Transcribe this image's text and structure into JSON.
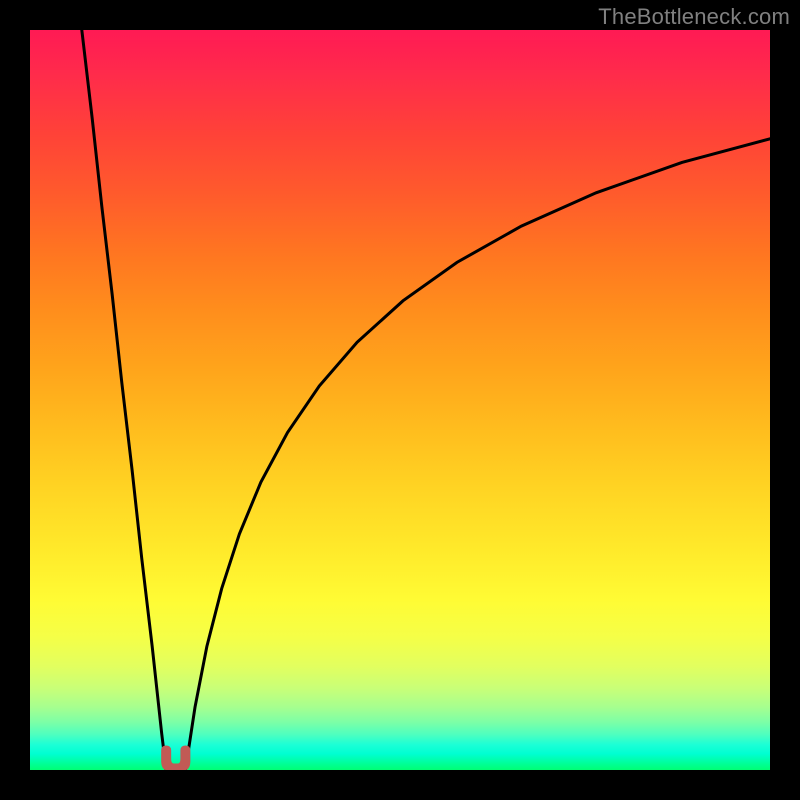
{
  "watermark": "TheBottleneck.com",
  "colors": {
    "page_bg": "#000000",
    "curve_stroke": "#000000",
    "marker_fill": "#c15a55",
    "watermark": "#808080",
    "gradient_top": "#ff1a54",
    "gradient_bottom": "#00ff74"
  },
  "chart_data": {
    "type": "line",
    "title": "",
    "xlabel": "",
    "ylabel": "",
    "xlim": [
      0,
      100
    ],
    "ylim": [
      0,
      100
    ],
    "grid": false,
    "legend": false,
    "note": "Values estimated from pixel positions; chart displays a bottleneck curve reaching 0 near x≈19.",
    "series": [
      {
        "name": "left-branch",
        "x": [
          7.0,
          8.4,
          9.7,
          11.1,
          12.4,
          13.8,
          15.1,
          16.5,
          17.8,
          18.4
        ],
        "y": [
          100.0,
          88.1,
          76.2,
          64.3,
          52.4,
          40.5,
          28.6,
          16.8,
          4.9,
          0.0
        ]
      },
      {
        "name": "right-branch",
        "x": [
          21.0,
          22.3,
          23.9,
          25.9,
          28.3,
          31.2,
          34.8,
          39.1,
          44.2,
          50.4,
          57.7,
          66.4,
          76.5,
          88.1,
          100.0
        ],
        "y": [
          0.0,
          8.5,
          16.7,
          24.5,
          31.9,
          38.9,
          45.6,
          51.9,
          57.8,
          63.4,
          68.6,
          73.5,
          78.0,
          82.1,
          85.3
        ]
      }
    ],
    "marker": {
      "name": "bottleneck-minimum",
      "x_range": [
        18.4,
        21.0
      ],
      "y": 0.0
    }
  }
}
